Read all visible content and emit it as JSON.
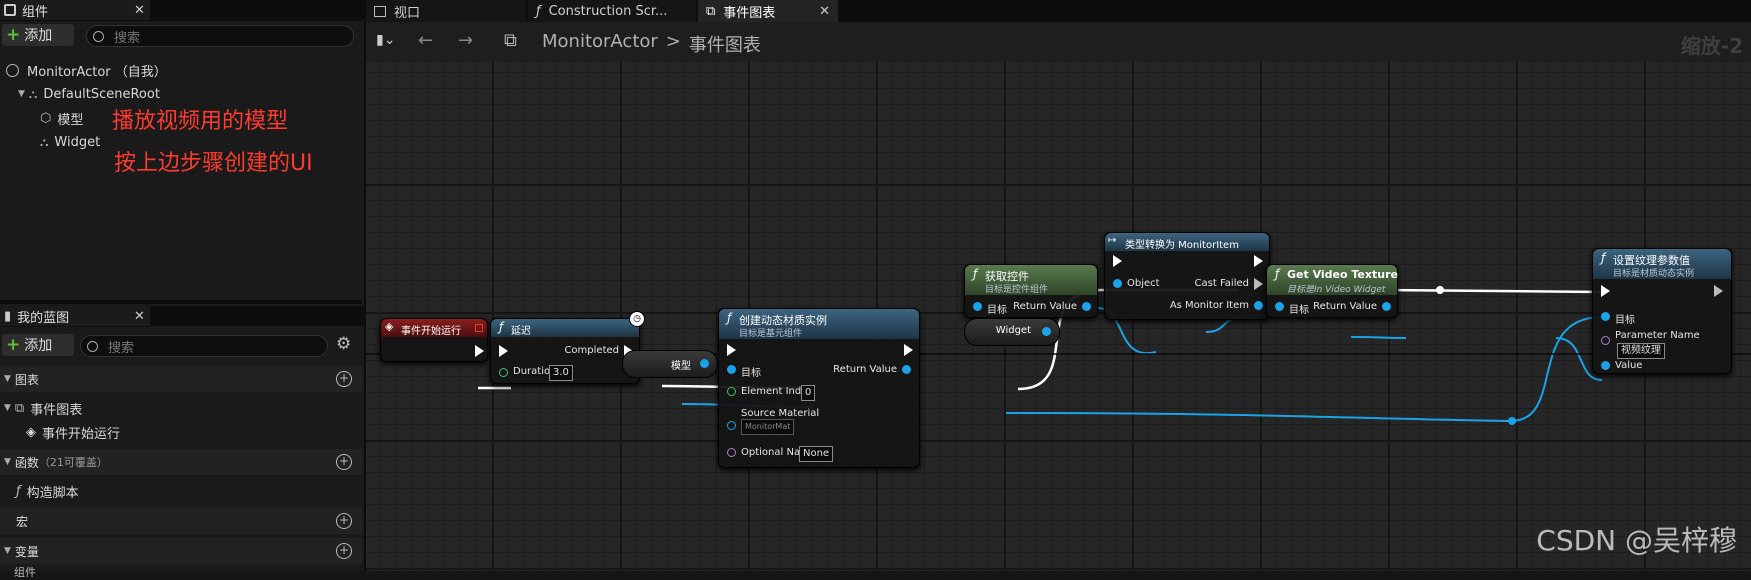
{
  "components_panel": {
    "title": "组件",
    "add_label": "添加",
    "search_placeholder": "搜索",
    "root_actor": "MonitorActor （自我）",
    "scene_root": "DefaultSceneRoot",
    "items": [
      "模型",
      "Widget"
    ],
    "annotations": [
      "播放视频用的模型",
      "按上边步骤创建的UI"
    ]
  },
  "blueprint_panel": {
    "title": "我的蓝图",
    "add_label": "添加",
    "search_placeholder": "搜索",
    "sections": {
      "graphs": "图表",
      "event_graph": "事件图表",
      "begin_play": "事件开始运行",
      "functions": "函数",
      "functions_note": "（21可覆盖）",
      "construction": "构造脚本",
      "macros": "宏",
      "variables": "变量",
      "components": "组件"
    }
  },
  "tabs": [
    {
      "label": "视口"
    },
    {
      "label": "Construction Scr..."
    },
    {
      "label": "事件图表"
    }
  ],
  "toolbar": {
    "breadcrumb_root": "MonitorActor",
    "breadcrumb_sep": ">",
    "breadcrumb_current": "事件图表",
    "zoom": "缩放-2"
  },
  "nodes": {
    "begin_play": {
      "title": "事件开始运行"
    },
    "delay": {
      "title": "延迟",
      "completed": "Completed",
      "duration_label": "Duration",
      "duration_value": "3.0"
    },
    "create_mat": {
      "title": "创建动态材质实例",
      "subtitle": "目标是基元组件",
      "target": "目标",
      "return": "Return Value",
      "element_index": "Element Index",
      "element_index_value": "0",
      "source_material": "Source Material",
      "source_material_value": "MonitorMat",
      "optional_name": "Optional Name",
      "optional_name_value": "None"
    },
    "model_var": {
      "label": "模型"
    },
    "get_widget": {
      "title": "获取控件",
      "subtitle": "目标是控件组件",
      "target": "目标",
      "return": "Return Value"
    },
    "widget_var": {
      "label": "Widget"
    },
    "cast": {
      "title": "类型转换为 MonitorItem",
      "object": "Object",
      "cast_failed": "Cast Failed",
      "as_item": "As Monitor Item"
    },
    "get_video": {
      "title": "Get Video Texture",
      "subtitle": "目标是In Video Widget",
      "target": "目标",
      "return": "Return Value"
    },
    "set_param": {
      "title": "设置纹理参数值",
      "subtitle": "目标是材质动态实例",
      "target": "目标",
      "param_name": "Parameter Name",
      "param_value": "视频纹理",
      "value": "Value"
    }
  },
  "watermark": "CSDN @吴梓穆",
  "colors": {
    "exec": "#ffffff",
    "object_pin": "#1aa3e8",
    "int_pin": "#3cc46a",
    "annotation": "#ff3b30"
  }
}
